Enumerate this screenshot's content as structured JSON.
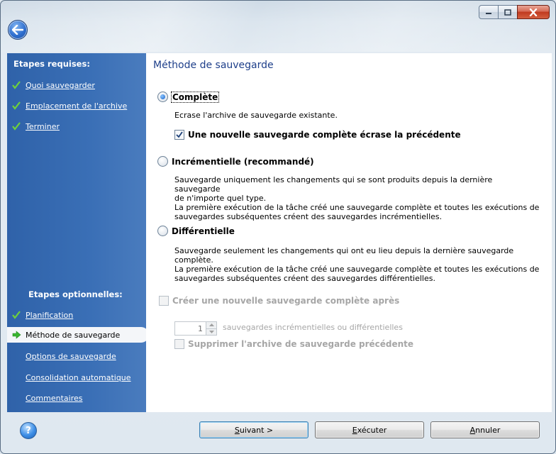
{
  "sidebar": {
    "required_heading": "Etapes requises:",
    "required_items": [
      {
        "label": "Quoi sauvegarder"
      },
      {
        "label": "Emplacement de l'archive"
      },
      {
        "label": "Terminer"
      }
    ],
    "optional_heading": "Etapes optionnelles:",
    "optional_items": [
      {
        "label": "Planification",
        "state": "done"
      },
      {
        "label": "Méthode de sauvegarde",
        "state": "current"
      },
      {
        "label": "Options de sauvegarde"
      },
      {
        "label": "Consolidation automatique"
      },
      {
        "label": "Commentaires"
      }
    ]
  },
  "content": {
    "title": "Méthode de sauvegarde",
    "options": [
      {
        "label": "Complète",
        "selected": true,
        "description": "Ecrase l'archive de sauvegarde existante.",
        "checkbox": {
          "label": "Une nouvelle sauvegarde complète écrase la précédente",
          "checked": true
        }
      },
      {
        "label": "Incrémentielle (recommandé)",
        "selected": false,
        "description_line1": "Sauvegarde uniquement les changements qui se sont produits depuis la dernière sauvegarde",
        "description_line2": "de n'importe quel type.",
        "description_line3": "La première exécution de la tâche créé une sauvegarde complète et toutes les exécutions de",
        "description_line4": "sauvegardes subséquentes créent des sauvegardes incrémentielles."
      },
      {
        "label": "Différentielle",
        "selected": false,
        "description_line1": "Sauvegarde seulement les changements qui ont eu lieu depuis la dernière sauvegarde",
        "description_line2": "complète.",
        "description_line3": "La première exécution de la tâche créé une sauvegarde complète et toutes les exécutions de",
        "description_line4": "sauvegardes subséquentes créent des sauvegardes différentielles."
      }
    ],
    "new_full_checkbox": {
      "label": "Créer une nouvelle sauvegarde complète après",
      "checked": false,
      "enabled": false
    },
    "spinner": {
      "value": "1",
      "suffix": "sauvegardes incrémentielles ou différentielles"
    },
    "delete_previous_checkbox": {
      "label": "Supprimer l'archive de sauvegarde précédente",
      "checked": false,
      "enabled": false
    }
  },
  "buttons": {
    "next": {
      "accel": "S",
      "rest": "uivant >"
    },
    "execute": {
      "accel": "E",
      "rest": "xécuter"
    },
    "cancel": {
      "accel": "A",
      "rest": "nnuler"
    }
  },
  "colors": {
    "sidebar": "#3a6fb6",
    "title": "#1e3f8a",
    "check": "#5cb82f"
  }
}
